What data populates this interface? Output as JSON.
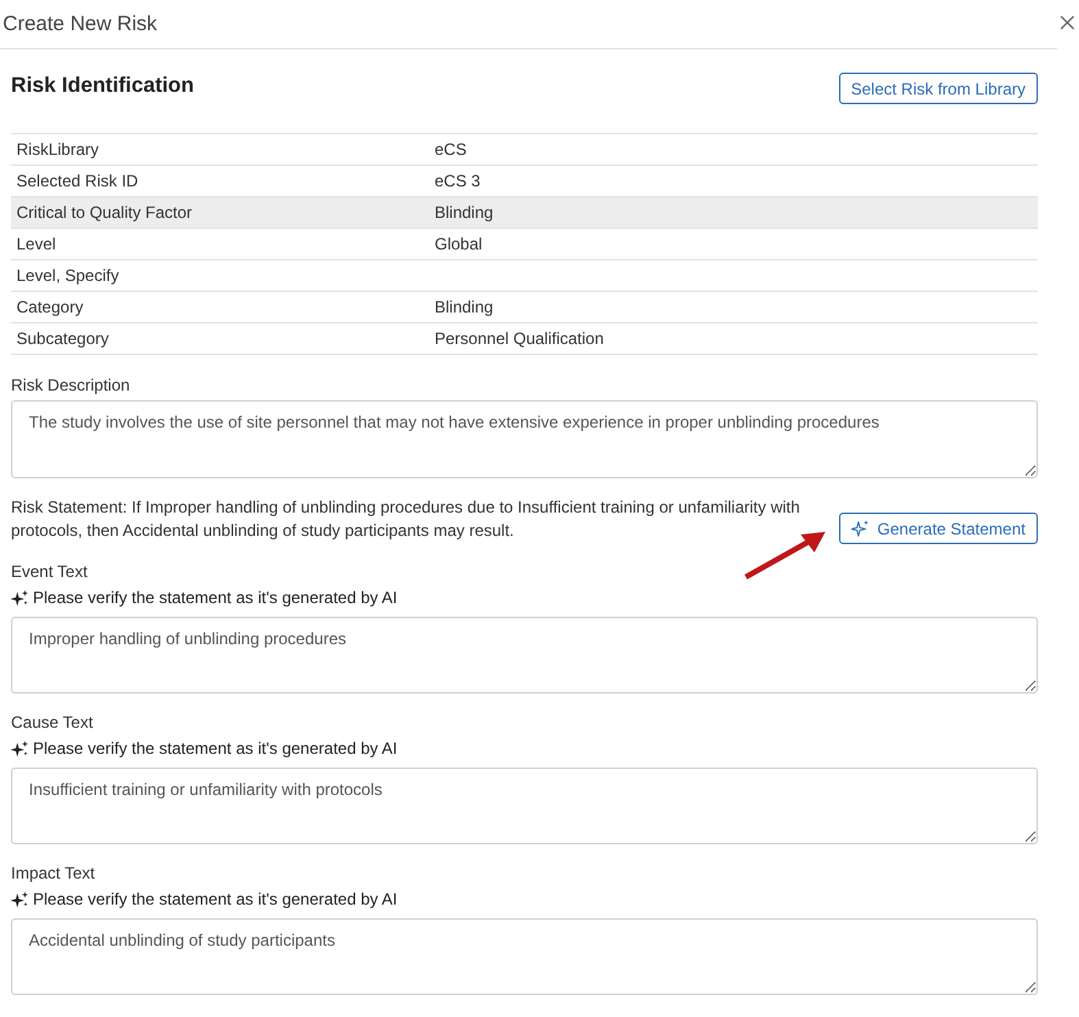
{
  "dialog": {
    "title": "Create New Risk"
  },
  "section": {
    "title": "Risk Identification",
    "library_button": "Select Risk from Library"
  },
  "details": [
    {
      "label": "RiskLibrary",
      "value": "eCS",
      "highlighted": false
    },
    {
      "label": "Selected Risk ID",
      "value": "eCS 3",
      "highlighted": false
    },
    {
      "label": "Critical to Quality Factor",
      "value": "Blinding",
      "highlighted": true
    },
    {
      "label": "Level",
      "value": "Global",
      "highlighted": false
    },
    {
      "label": "Level, Specify",
      "highlighted": false
    },
    {
      "label": "Category",
      "value": "Blinding",
      "highlighted": false
    },
    {
      "label": "Subcategory",
      "value": "Personnel Qualification",
      "highlighted": false
    }
  ],
  "risk_description": {
    "label": "Risk Description",
    "value": "The study involves the use of site personnel that may not have extensive experience in proper unblinding procedures"
  },
  "risk_statement": {
    "text": "Risk Statement: If Improper handling of unblinding procedures due to Insufficient training or unfamiliarity with protocols, then Accidental unblinding of study participants may result.",
    "button": "Generate Statement"
  },
  "generated_fields": [
    {
      "label": "Event Text",
      "hint": "Please verify the statement as it's generated by AI",
      "value": "Improper handling of unblinding procedures"
    },
    {
      "label": "Cause Text",
      "hint": "Please verify the statement as it's generated by AI",
      "value": "Insufficient training or unfamiliarity with protocols"
    },
    {
      "label": "Impact Text",
      "hint": "Please verify the statement as it's generated by AI",
      "value": "Accidental unblinding of study participants"
    }
  ]
}
